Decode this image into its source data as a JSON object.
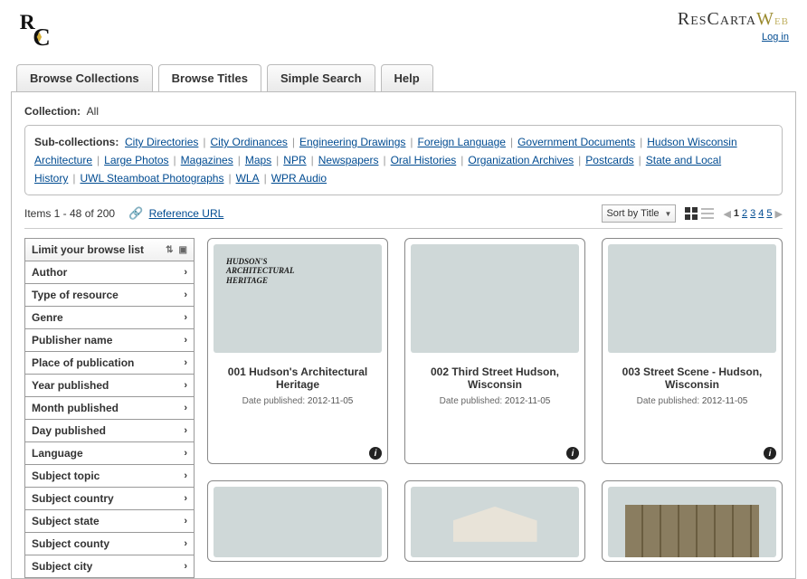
{
  "brand": {
    "res": "Res",
    "carta": "Carta",
    "w": "W",
    "eb": "eb"
  },
  "login_label": "Log in",
  "tabs": [
    "Browse Collections",
    "Browse Titles",
    "Simple Search",
    "Help"
  ],
  "collection_label": "Collection:",
  "collection_value": "All",
  "subcoll_label": "Sub-collections:",
  "subcollections": [
    "City Directories",
    "City Ordinances",
    "Engineering Drawings",
    "Foreign Language",
    "Government Documents",
    "Hudson Wisconsin Architecture",
    "Large Photos",
    "Magazines",
    "Maps",
    "NPR",
    "Newspapers",
    "Oral Histories",
    "Organization Archives",
    "Postcards",
    "State and Local History",
    "UWL Steamboat Photographs",
    "WLA",
    "WPR Audio"
  ],
  "items_text": "Items 1 - 48 of 200",
  "reference_url": "Reference URL",
  "sort_label": "Sort by Title",
  "pages": [
    "1",
    "2",
    "3",
    "4",
    "5"
  ],
  "facets_header": "Limit your browse list",
  "facets": [
    "Author",
    "Type of resource",
    "Genre",
    "Publisher name",
    "Place of publication",
    "Year published",
    "Month published",
    "Day published",
    "Language",
    "Subject topic",
    "Subject country",
    "Subject state",
    "Subject county",
    "Subject city"
  ],
  "date_label": "Date published:",
  "cards": [
    {
      "title": "001 Hudson's Architectural Heritage",
      "date": "2012-11-05"
    },
    {
      "title": "002 Third Street Hudson, Wisconsin",
      "date": "2012-11-05"
    },
    {
      "title": "003 Street Scene - Hudson, Wisconsin",
      "date": "2012-11-05"
    }
  ]
}
